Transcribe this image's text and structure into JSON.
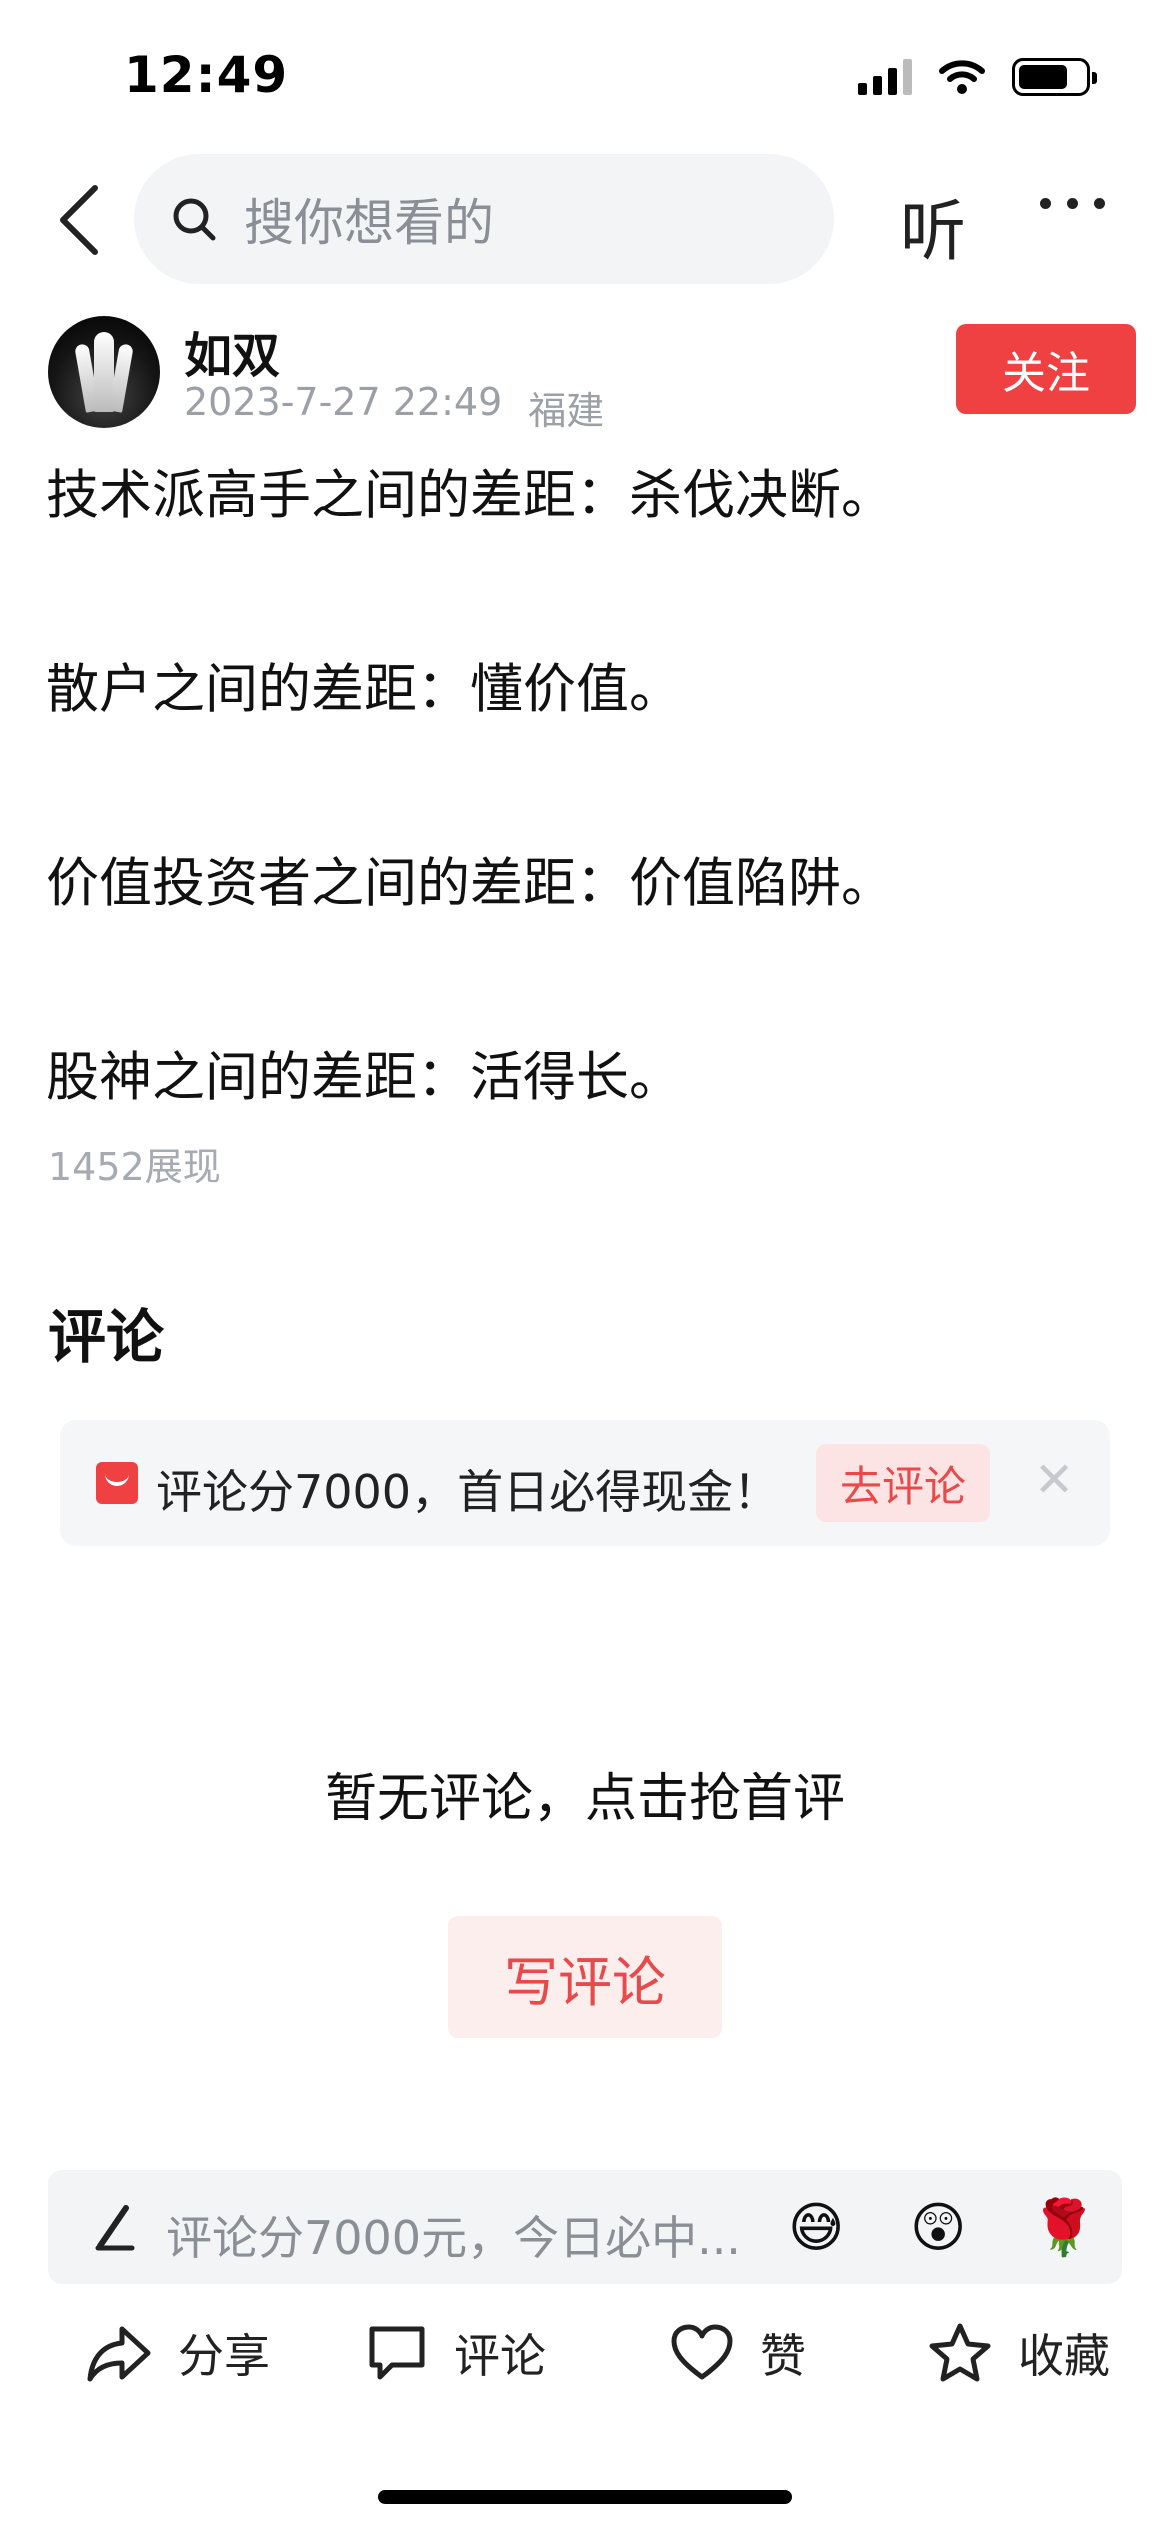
{
  "status_bar": {
    "time": "12:49"
  },
  "nav": {
    "search_placeholder": "搜你想看的",
    "listen_label": "听"
  },
  "post": {
    "author_name": "如双",
    "datetime": "2023-7-27 22:49",
    "location": "福建",
    "follow_label": "关注",
    "lines": [
      "技术派高手之间的差距：杀伐决断。",
      "散户之间的差距：懂价值。",
      "价值投资者之间的差距：价值陷阱。",
      "股神之间的差距：活得长。"
    ],
    "views": "1452展现"
  },
  "comments": {
    "title": "评论",
    "promo_text": "评论分7000，首日必得现金！",
    "promo_button": "去评论",
    "empty_text": "暂无评论，点击抢首评",
    "write_button": "写评论"
  },
  "comment_bar": {
    "placeholder": "评论分7000元，今日必中...",
    "emojis": [
      "😅",
      "😲",
      "🌹"
    ]
  },
  "actions": {
    "share": "分享",
    "comment": "评论",
    "like": "赞",
    "favorite": "收藏"
  },
  "colors": {
    "accent_red": "#f04142",
    "muted_gray": "#9aa0a6",
    "search_bg": "#f3f4f6"
  }
}
